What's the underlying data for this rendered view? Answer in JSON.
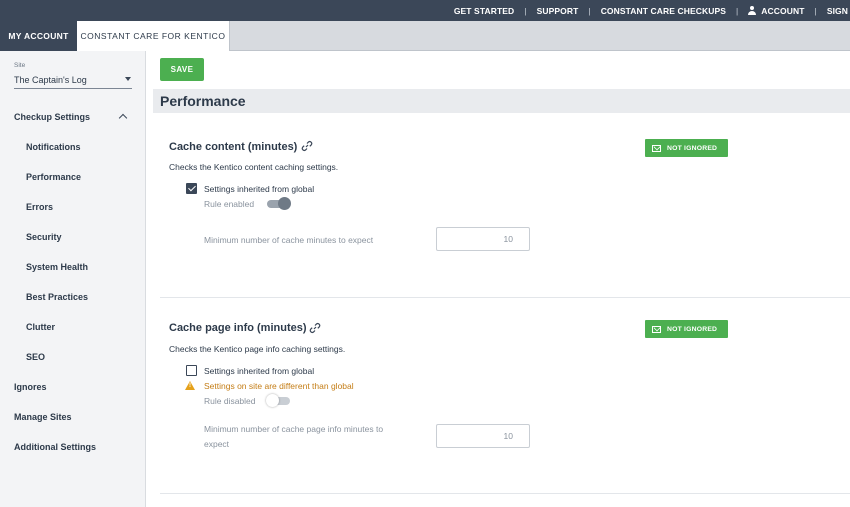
{
  "topnav": {
    "links": [
      "GET STARTED",
      "SUPPORT",
      "CONSTANT CARE CHECKUPS"
    ],
    "account": "ACCOUNT",
    "sign": "SIGN"
  },
  "tabs": {
    "my_account": "MY ACCOUNT",
    "constant_care": "CONSTANT CARE FOR KENTICO"
  },
  "sidebar": {
    "site_label": "Site",
    "site_value": "The Captain's Log",
    "checkup_settings": "Checkup Settings",
    "sub_items": [
      "Notifications",
      "Performance",
      "Errors",
      "Security",
      "System Health",
      "Best Practices",
      "Clutter",
      "SEO"
    ],
    "top_items": [
      "Ignores",
      "Manage Sites",
      "Additional Settings"
    ]
  },
  "main": {
    "save_label": "SAVE",
    "section_title": "Performance",
    "rules": [
      {
        "title": "Cache content (minutes)",
        "description": "Checks the Kentico content caching settings.",
        "badge": "NOT IGNORED",
        "inherited_label": "Settings inherited from global",
        "inherited_checked": true,
        "rule_state_label": "Rule enabled",
        "rule_enabled": true,
        "param_label": "Minimum number of cache minutes to expect",
        "param_value": "10"
      },
      {
        "title": "Cache page info (minutes)",
        "description": "Checks the Kentico page info caching settings.",
        "badge": "NOT IGNORED",
        "inherited_label": "Settings inherited from global",
        "inherited_checked": false,
        "warning": "Settings on site are different than global",
        "rule_state_label": "Rule disabled",
        "rule_enabled": false,
        "param_label_line1": "Minimum number of cache page info minutes to",
        "param_label_line2": "expect",
        "param_value": "10"
      }
    ]
  }
}
